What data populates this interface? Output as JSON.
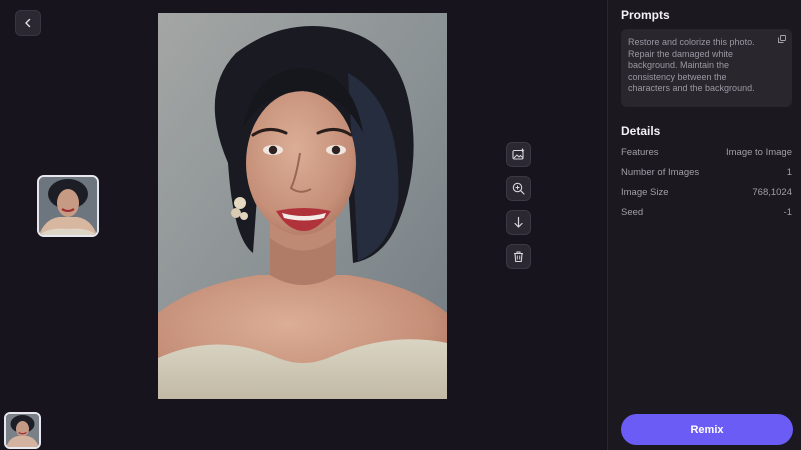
{
  "prompts": {
    "heading": "Prompts",
    "text": "Restore and colorize this photo. Repair the damaged white background. Maintain the consistency between the characters and the background."
  },
  "details": {
    "heading": "Details",
    "rows": [
      {
        "label": "Features",
        "value": "Image to Image"
      },
      {
        "label": "Number of Images",
        "value": "1"
      },
      {
        "label": "Image Size",
        "value": "768,1024"
      },
      {
        "label": "Seed",
        "value": "-1"
      }
    ]
  },
  "actions": {
    "remix_label": "Remix"
  },
  "icons": {
    "back": "chevron-left-icon",
    "set_as_input": "image-plus-icon",
    "zoom": "zoom-in-icon",
    "download": "arrow-down-icon",
    "delete": "trash-icon",
    "copy": "copy-icon"
  },
  "colors": {
    "background": "#17141d",
    "panel": "#1b1820",
    "accent": "#6b5cf5"
  }
}
